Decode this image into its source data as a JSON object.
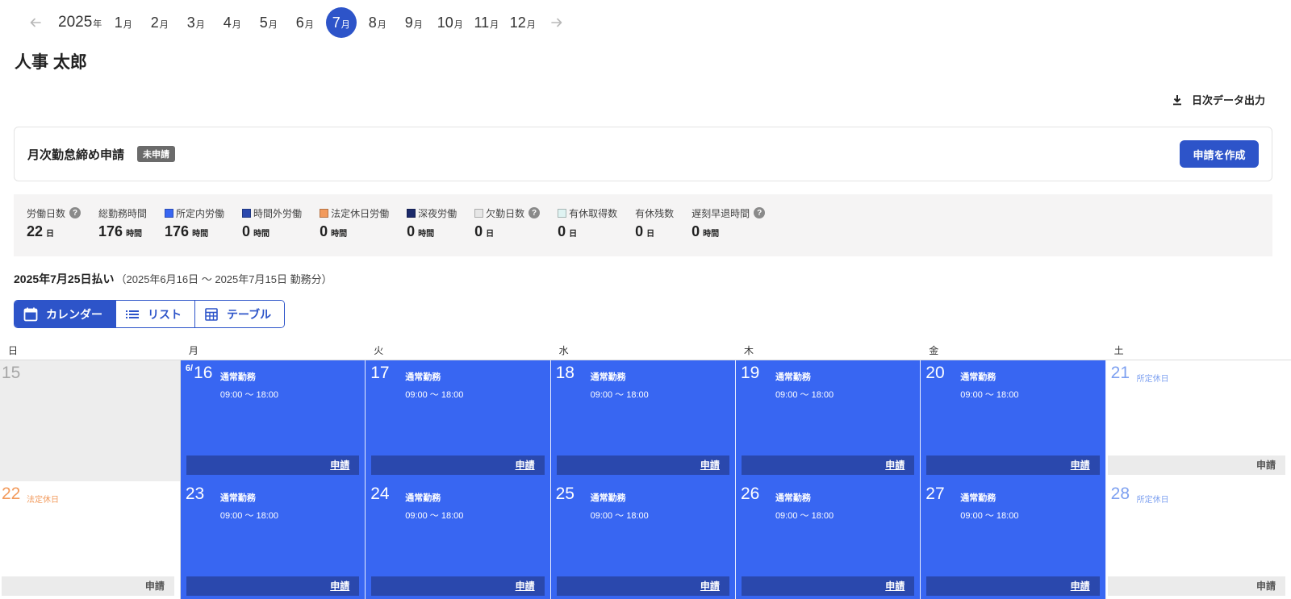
{
  "nav": {
    "year": "2025",
    "year_unit": "年",
    "month_unit": "月",
    "months": [
      "1",
      "2",
      "3",
      "4",
      "5",
      "6",
      "7",
      "8",
      "9",
      "10",
      "11",
      "12"
    ],
    "active_month": "7"
  },
  "employee": {
    "name": "人事 太郎"
  },
  "export": {
    "label": "日次データ出力"
  },
  "monthly_close": {
    "title": "月次勤怠締め申請",
    "status": "未申請",
    "create_label": "申請を作成"
  },
  "summary": [
    {
      "label": "労働日数",
      "value": "22",
      "unit": "日",
      "help": true
    },
    {
      "label": "総勤務時間",
      "value": "176",
      "unit": "時間"
    },
    {
      "label": "所定内労働",
      "value": "176",
      "unit": "時間",
      "color": "#3866f2"
    },
    {
      "label": "時間外労働",
      "value": "0",
      "unit": "時間",
      "color": "#2a48ad"
    },
    {
      "label": "法定休日労働",
      "value": "0",
      "unit": "時間",
      "color": "#f29a5c"
    },
    {
      "label": "深夜労働",
      "value": "0",
      "unit": "時間",
      "color": "#1b2a6b"
    },
    {
      "label": "欠勤日数",
      "value": "0",
      "unit": "日",
      "color": "#e6e6e6",
      "help": true
    },
    {
      "label": "有休取得数",
      "value": "0",
      "unit": "日",
      "color": "#dff3f2"
    },
    {
      "label": "有休残数",
      "value": "0",
      "unit": "日"
    },
    {
      "label": "遅刻早退時間",
      "value": "0",
      "unit": "時間",
      "help": true
    }
  ],
  "pay": {
    "title": "2025年7月25日払い",
    "period": "（2025年6月16日 ～ 2025年7月15日 勤務分）"
  },
  "view_toggle": {
    "calendar": "カレンダー",
    "list": "リスト",
    "table": "テーブル"
  },
  "calendar": {
    "weekdays": [
      "日",
      "月",
      "火",
      "水",
      "木",
      "金",
      "土"
    ],
    "apply_label": "申請",
    "weeks": [
      [
        {
          "day": "15",
          "kind": "past"
        },
        {
          "day": "16",
          "prefix": "6/",
          "kind": "work",
          "type": "通常勤務",
          "time": "09:00 ～ 18:00"
        },
        {
          "day": "17",
          "kind": "work",
          "type": "通常勤務",
          "time": "09:00 ～ 18:00"
        },
        {
          "day": "18",
          "kind": "work",
          "type": "通常勤務",
          "time": "09:00 ～ 18:00"
        },
        {
          "day": "19",
          "kind": "work",
          "type": "通常勤務",
          "time": "09:00 ～ 18:00"
        },
        {
          "day": "20",
          "kind": "work",
          "type": "通常勤務",
          "time": "09:00 ～ 18:00"
        },
        {
          "day": "21",
          "kind": "prescribed",
          "type": "所定休日"
        }
      ],
      [
        {
          "day": "22",
          "kind": "legal",
          "type": "法定休日"
        },
        {
          "day": "23",
          "kind": "work",
          "type": "通常勤務",
          "time": "09:00 ～ 18:00"
        },
        {
          "day": "24",
          "kind": "work",
          "type": "通常勤務",
          "time": "09:00 ～ 18:00"
        },
        {
          "day": "25",
          "kind": "work",
          "type": "通常勤務",
          "time": "09:00 ～ 18:00"
        },
        {
          "day": "26",
          "kind": "work",
          "type": "通常勤務",
          "time": "09:00 ～ 18:00"
        },
        {
          "day": "27",
          "kind": "work",
          "type": "通常勤務",
          "time": "09:00 ～ 18:00"
        },
        {
          "day": "28",
          "kind": "prescribed",
          "type": "所定休日"
        }
      ]
    ]
  }
}
